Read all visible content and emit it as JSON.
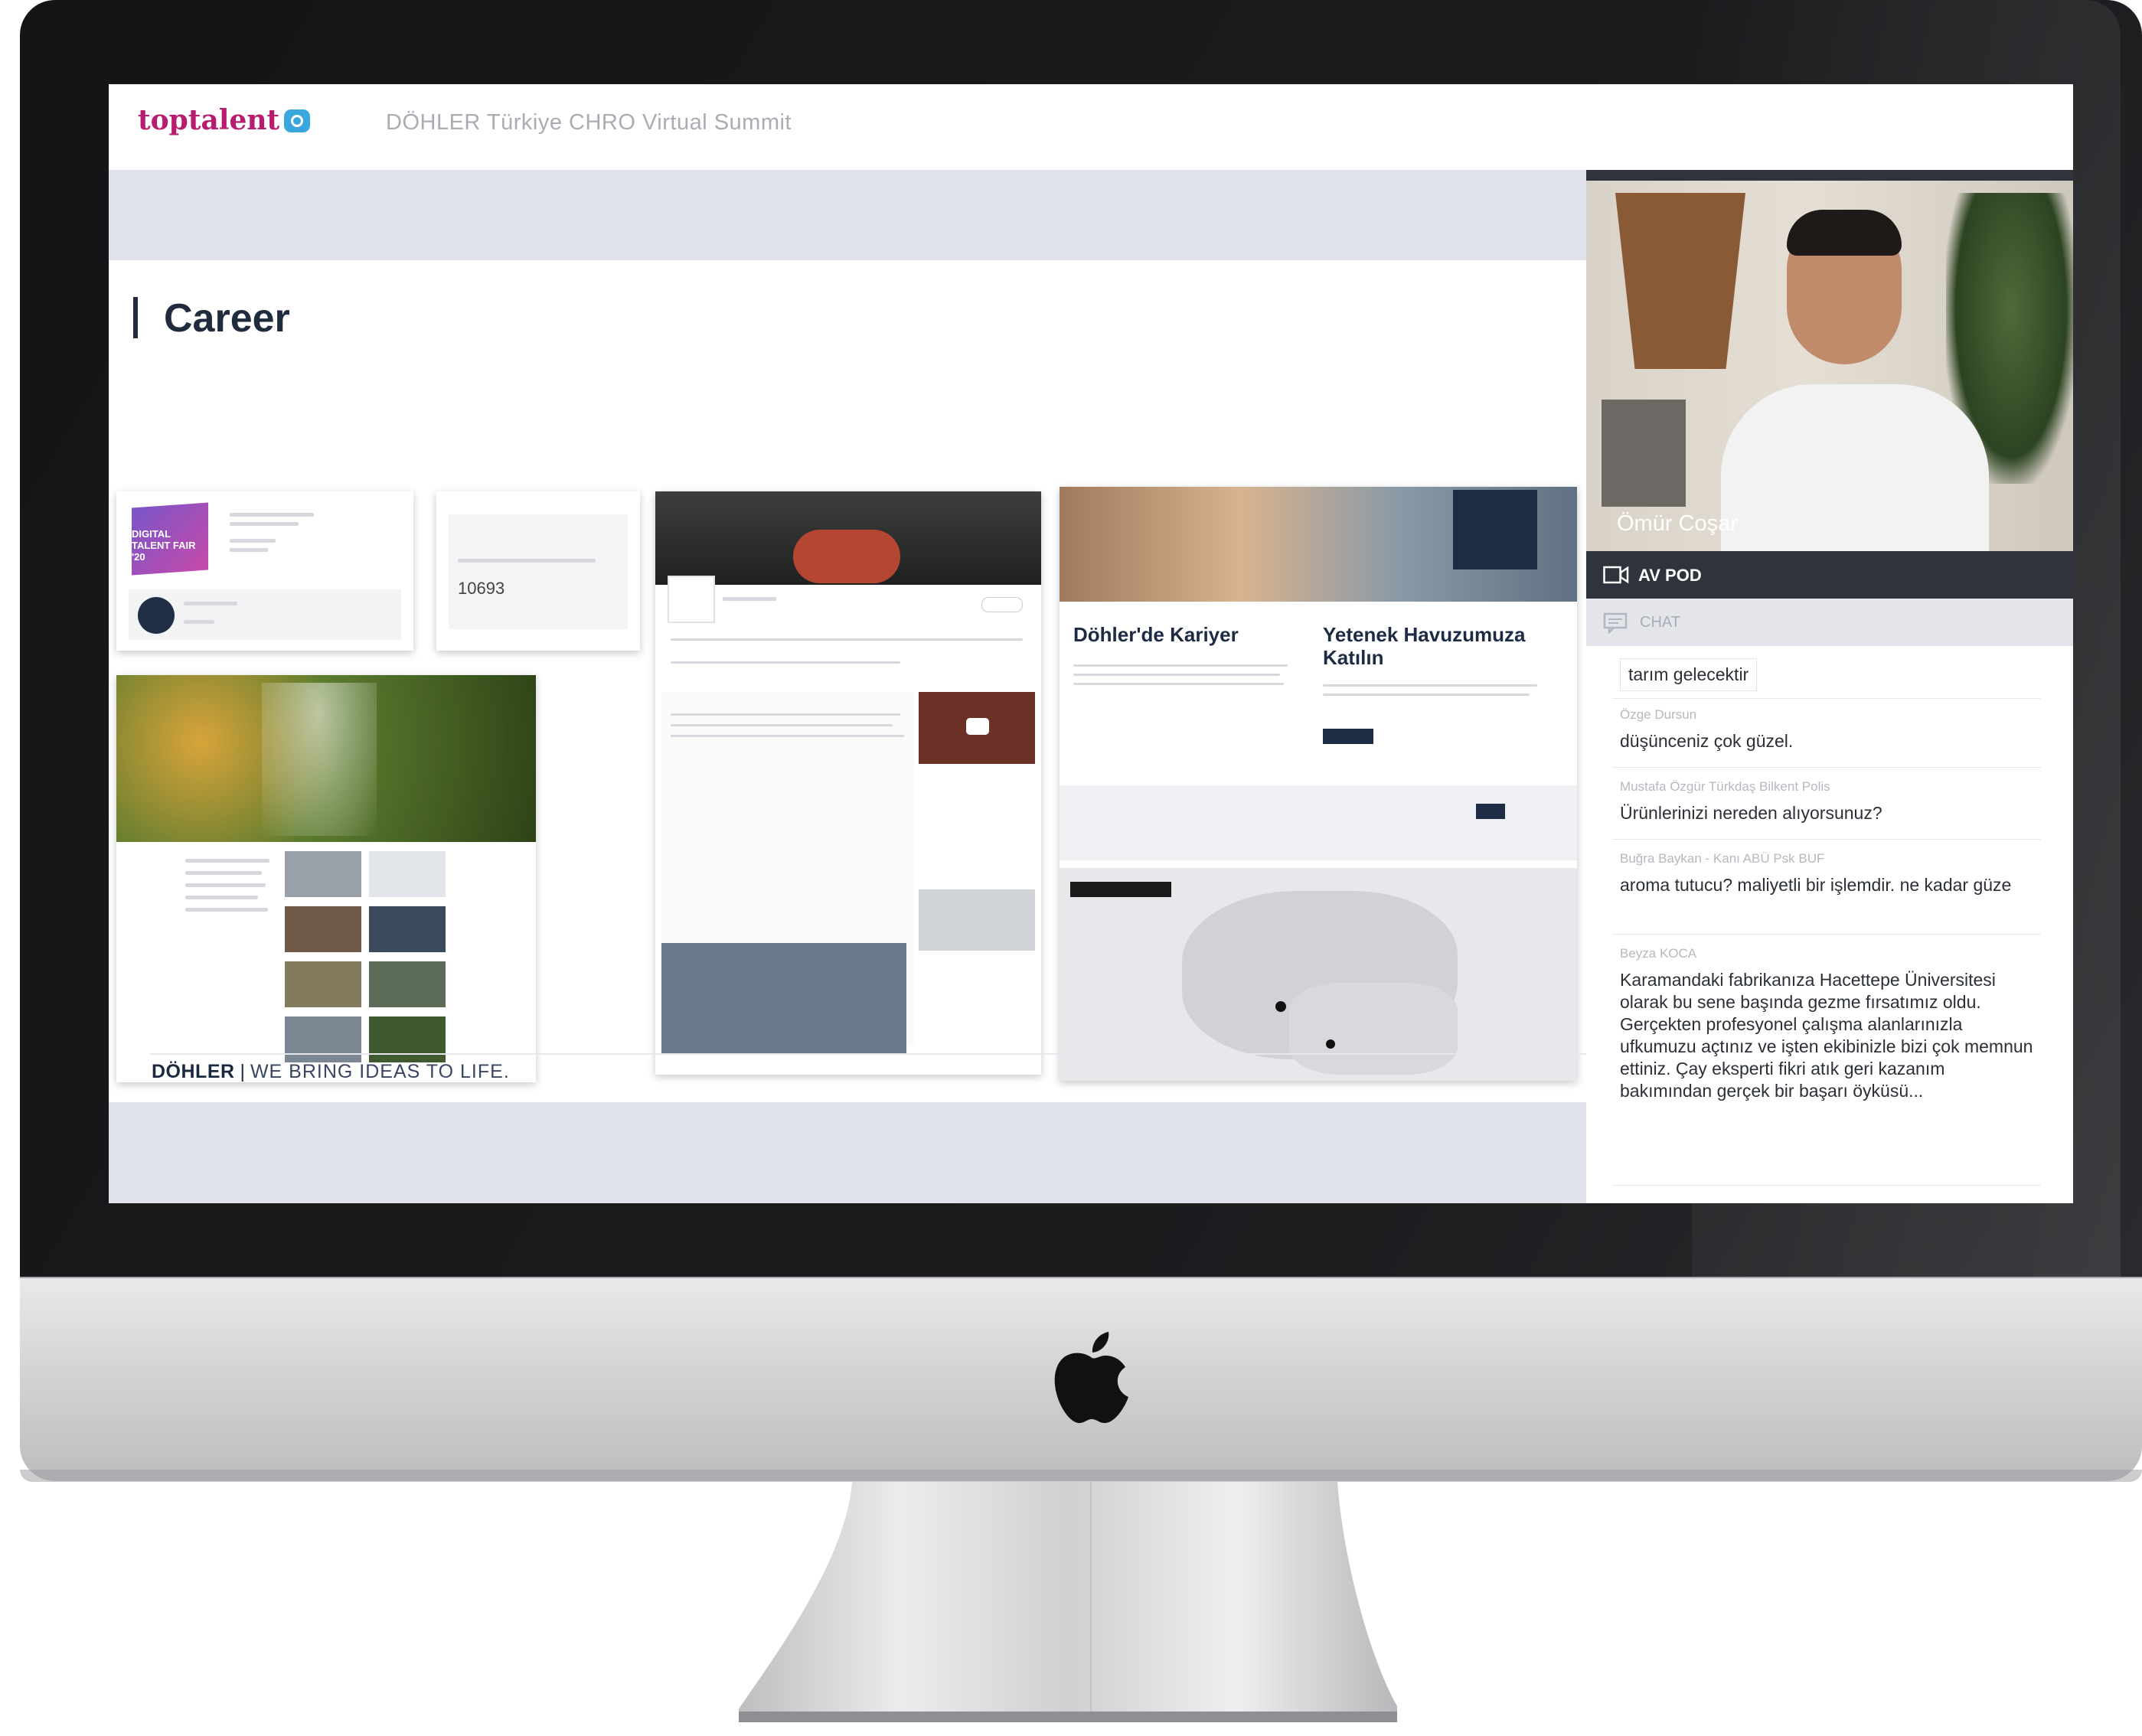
{
  "app": {
    "brand": "toptalent",
    "event_title": "DÖHLER Türkiye CHRO Virtual Summit"
  },
  "page": {
    "title": "Career"
  },
  "cards": {
    "fair_title": "DIGITAL TALENT FAIR '20",
    "counter_value": "10693",
    "karriere_heading": "Döhler'de Kariyer",
    "talent_pool_heading": "Yetenek Havuzumuza Katılın"
  },
  "footer": {
    "brand": "DÖHLER",
    "tagline": "WE BRING IDEAS TO LIFE."
  },
  "video": {
    "speaker_name": "Ömür Coşar"
  },
  "panel": {
    "avpod_label": "AV POD",
    "chat_label": "CHAT"
  },
  "chat": {
    "messages": [
      {
        "author": "",
        "text": "tarım gelecektir"
      },
      {
        "author": "Özge Dursun",
        "text": "düşünceniz çok güzel."
      },
      {
        "author": "Mustafa Özgür Türkdaş Bilkent Polis",
        "text": "Ürünlerinizi nereden alıyorsunuz?"
      },
      {
        "author": "Buğra Baykan - Kanı ABÜ Psk BUF",
        "text": "aroma tutucu? maliyetli bir işlemdir. ne kadar güze"
      },
      {
        "author": "Beyza KOCA",
        "text": "Karamandaki fabrikanıza Hacettepe Üniversitesi olarak bu sene başında gezme fırsatımız oldu. Gerçekten profesyonel çalışma alanlarınızla ufkumuzu açtınız ve işten ekibinizle bizi çok memnun ettiniz. Çay eksperti fikri atık geri kazanım bakımından gerçek bir başarı öyküsü..."
      }
    ]
  }
}
